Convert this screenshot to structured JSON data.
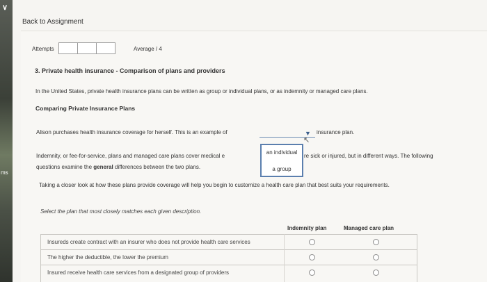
{
  "nav": {
    "back_label": "Back to Assignment"
  },
  "side": {
    "label": "ms"
  },
  "attempts": {
    "label": "Attempts",
    "average_label": "Average / 4"
  },
  "question": {
    "title": "3. Private health insurance - Comparison of plans and providers",
    "intro": "In the United States, private health insurance plans can be written as group or individual plans, or as indemnity or managed care plans.",
    "section_title": "Comparing Private Insurance Plans",
    "alison_text": "Alison purchases health insurance coverage for herself. This is an example of",
    "alison_suffix": "insurance plan.",
    "dropdown_options": [
      "an individual",
      "a group"
    ],
    "indemnity_line1": "Indemnity, or fee-for-service, plans and managed care plans cover medical e",
    "indemnity_line1b": "re sick or injured, but in different ways. The following",
    "indemnity_line2_pre": "questions examine the",
    "indemnity_line2_bold": "general",
    "indemnity_line2_post": "differences between the two plans.",
    "taking_text": "Taking a closer look at how these plans provide coverage will help you begin to customize a health care plan that best suits your requirements.",
    "select_instruction": "Select the plan that most closely matches each given description."
  },
  "table": {
    "col_indemnity": "Indemnity plan",
    "col_managed": "Managed care plan",
    "rows": [
      "Insureds create contract with an insurer who does not provide health care services",
      "The higher the deductible, the lower the premium",
      "Insured receive health care services from a designated group of providers"
    ]
  },
  "colors": {
    "dropdown_border": "#5b7fae",
    "background": "#f6f5f2"
  }
}
